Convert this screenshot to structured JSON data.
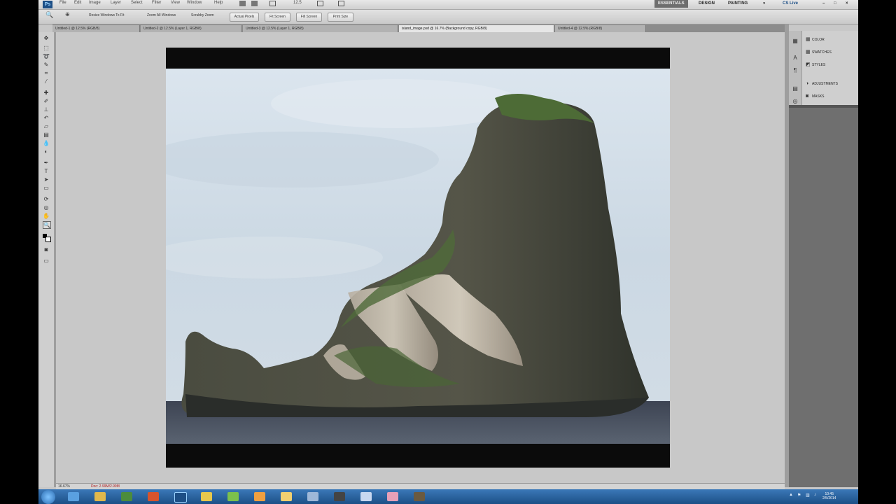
{
  "app": {
    "logo": "Ps"
  },
  "menubar": {
    "items": [
      "File",
      "Edit",
      "Image",
      "Layer",
      "Select",
      "Filter",
      "View",
      "Window",
      "Help"
    ],
    "zoom_value": "12.5",
    "workspaces": [
      "ESSENTIALS",
      "DESIGN",
      "PAINTING"
    ],
    "active_workspace": "ESSENTIALS",
    "cs_live": "CS Live"
  },
  "options": {
    "resize_windows": "Resize Windows To Fit",
    "zoom_all_windows": "Zoom All Windows",
    "scrubby_zoom": "Scrubby Zoom",
    "actual_pixels": "Actual Pixels",
    "fit_screen": "Fit Screen",
    "fill_screen": "Fill Screen",
    "print_size": "Print Size"
  },
  "document_tabs": [
    {
      "label": "Untitled-1 @ 12.5% (RGB/8)"
    },
    {
      "label": "Untitled-2 @ 12.5% (Layer 1, RGB/8)"
    },
    {
      "label": "Untitled-3 @ 12.5% (Layer 1, RGB/8)"
    },
    {
      "label": "island_image.psd @ 16.7% (Background copy, RGB/8)",
      "active": true
    },
    {
      "label": "Untitled-4 @ 12.5% (RGB/8)"
    }
  ],
  "panels": [
    {
      "icon": "color-icon",
      "label": "COLOR"
    },
    {
      "icon": "swatches-icon",
      "label": "SWATCHES"
    },
    {
      "icon": "styles-icon",
      "label": "STYLES"
    },
    {
      "icon": "adjustments-icon",
      "label": "ADJUSTMENTS"
    },
    {
      "icon": "masks-icon",
      "label": "MASKS"
    }
  ],
  "status": {
    "zoom": "16.67%",
    "doc_info": "Doc: 2.99M/2.99M"
  },
  "taskbar": {
    "clock_time": "10:45",
    "clock_date": "2/5/2014"
  },
  "colors": {
    "sky_top": "#d8e3ec",
    "sky_bottom": "#c9d6e1",
    "rock_dark": "#3e4035",
    "rock_light": "#c8c0b3",
    "vegetation": "#4d6b36",
    "water": "#3a4250",
    "taskbar": "#2b62a0"
  }
}
